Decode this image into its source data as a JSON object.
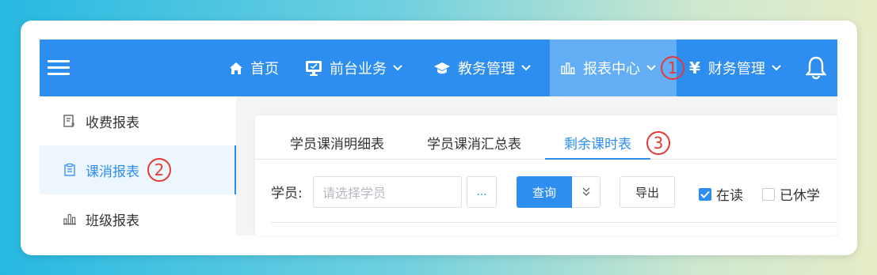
{
  "nav": {
    "items": [
      {
        "label": "首页",
        "icon": "home-icon"
      },
      {
        "label": "前台业务",
        "icon": "monitor-icon"
      },
      {
        "label": "教务管理",
        "icon": "graduation-cap-icon"
      },
      {
        "label": "报表中心",
        "icon": "bar-chart-icon",
        "active": true
      },
      {
        "label": "财务管理",
        "icon": "yen-icon"
      }
    ],
    "yen_symbol": "¥"
  },
  "sidebar": {
    "items": [
      {
        "label": "收费报表",
        "icon": "receipt-icon"
      },
      {
        "label": "课消报表",
        "icon": "clipboard-icon",
        "active": true
      },
      {
        "label": "班级报表",
        "icon": "bar-chart-icon"
      }
    ]
  },
  "tabs": [
    {
      "label": "学员课消明细表"
    },
    {
      "label": "学员课消汇总表"
    },
    {
      "label": "剩余课时表",
      "active": true
    }
  ],
  "filter": {
    "student_label": "学员:",
    "student_placeholder": "请选择学员",
    "dots_label": "...",
    "query_label": "查询",
    "export_label": "导出",
    "checkbox_enrolled": {
      "label": "在读",
      "checked": true
    },
    "checkbox_suspended": {
      "label": "已休学",
      "checked": false
    }
  },
  "annotations": {
    "one": "1",
    "two": "2",
    "three": "3"
  },
  "colors": {
    "accent": "#2d8ef0",
    "annotation": "#e53935"
  }
}
